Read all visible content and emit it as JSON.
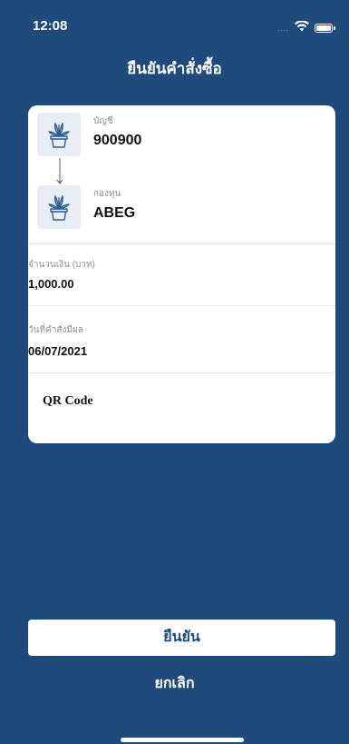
{
  "status_bar": {
    "time": "12:08",
    "signal": "....",
    "wifi_icon": "wifi-icon",
    "battery_icon": "battery-icon"
  },
  "header": {
    "title": "ยืนยันคำสั่งซื้อ"
  },
  "order": {
    "account_label": "บัญชี",
    "account_value": "900900",
    "fund_label": "กองทุน",
    "fund_value": "ABEG",
    "amount_label": "จำนวนเงิน (บาท)",
    "amount_value": "1,000.00",
    "effective_date_label": "วันที่คำสั่งมีผล",
    "effective_date_value": "06/07/2021",
    "qr_label": "QR Code"
  },
  "actions": {
    "confirm_label": "ยืนยัน",
    "cancel_label": "ยกเลิก"
  },
  "colors": {
    "background": "#1f4a7c",
    "card": "#ffffff",
    "icon_tile": "#e9eef4"
  }
}
